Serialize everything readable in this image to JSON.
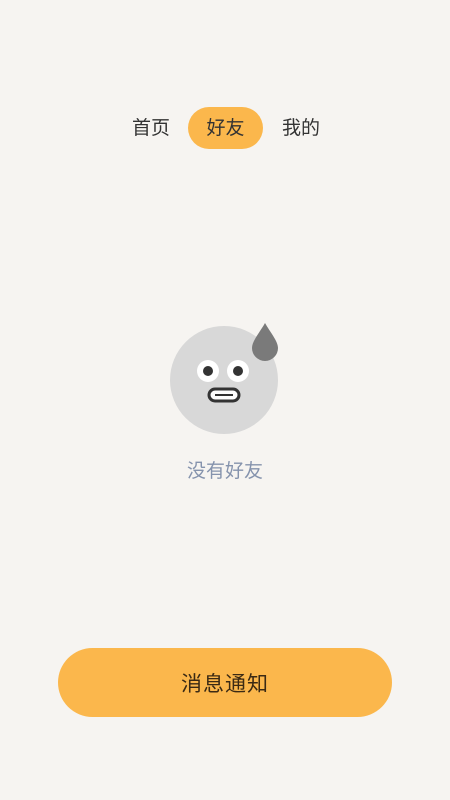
{
  "tabs": [
    {
      "label": "首页"
    },
    {
      "label": "好友"
    },
    {
      "label": "我的"
    }
  ],
  "empty_state": {
    "icon": "sweat-face-icon",
    "text": "没有好友"
  },
  "footer": {
    "button_label": "消息通知"
  },
  "colors": {
    "background": "#f6f4f1",
    "accent": "#fbb74c",
    "empty_text": "#8593ad"
  }
}
